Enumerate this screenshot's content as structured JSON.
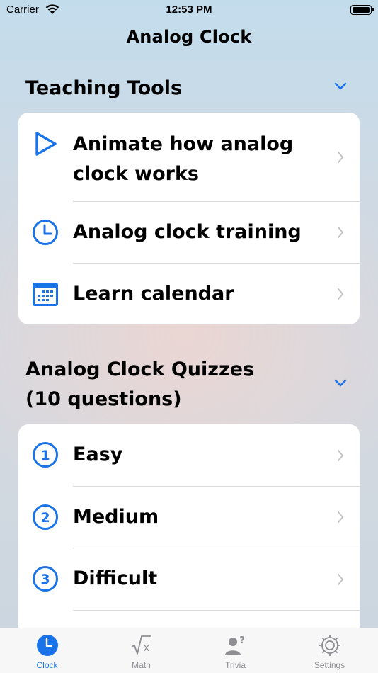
{
  "status_bar": {
    "carrier": "Carrier",
    "time": "12:53 PM"
  },
  "nav": {
    "title": "Analog Clock"
  },
  "sections": [
    {
      "title": "Teaching Tools",
      "items": [
        {
          "label": "Animate how analog clock works",
          "icon": "play-icon"
        },
        {
          "label": "Analog clock training",
          "icon": "clock-icon"
        },
        {
          "label": "Learn calendar",
          "icon": "calendar-icon"
        }
      ]
    },
    {
      "title": "Analog Clock Quizzes (10 questions)",
      "items": [
        {
          "label": "Easy",
          "icon": "number-1-circle-icon"
        },
        {
          "label": "Medium",
          "icon": "number-2-circle-icon"
        },
        {
          "label": "Difficult",
          "icon": "number-3-circle-icon"
        }
      ]
    }
  ],
  "tabs": [
    {
      "label": "Clock",
      "icon": "clock-tab-icon",
      "active": true
    },
    {
      "label": "Math",
      "icon": "square-root-icon",
      "active": false
    },
    {
      "label": "Trivia",
      "icon": "person-question-icon",
      "active": false
    },
    {
      "label": "Settings",
      "icon": "gear-icon",
      "active": false
    }
  ],
  "colors": {
    "accent": "#1a73e8",
    "inactive": "#8e8e93"
  }
}
